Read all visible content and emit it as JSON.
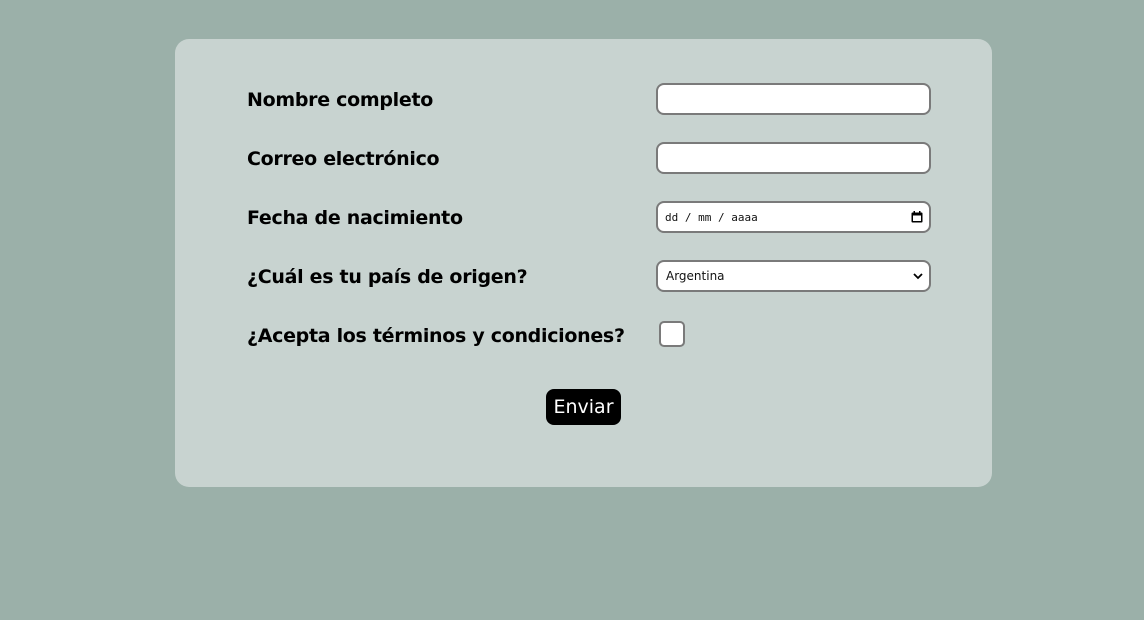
{
  "form": {
    "fields": [
      {
        "label": "Nombre completo",
        "value": ""
      },
      {
        "label": "Correo electrónico",
        "value": ""
      },
      {
        "label": "Fecha de nacimiento",
        "placeholder": "dd / mm / aaaa"
      },
      {
        "label": "¿Cuál es tu país de origen?",
        "selected": "Argentina"
      },
      {
        "label": "¿Acepta los términos y condiciones?",
        "checked": false
      }
    ],
    "submit_label": "Enviar"
  },
  "colors": {
    "page_background": "#9bb0a9",
    "card_background": "#c8d3d0",
    "button_background": "#000000",
    "button_text": "#ffffff"
  },
  "icons": {
    "date": "calendar-icon",
    "select": "chevron-down-icon"
  }
}
